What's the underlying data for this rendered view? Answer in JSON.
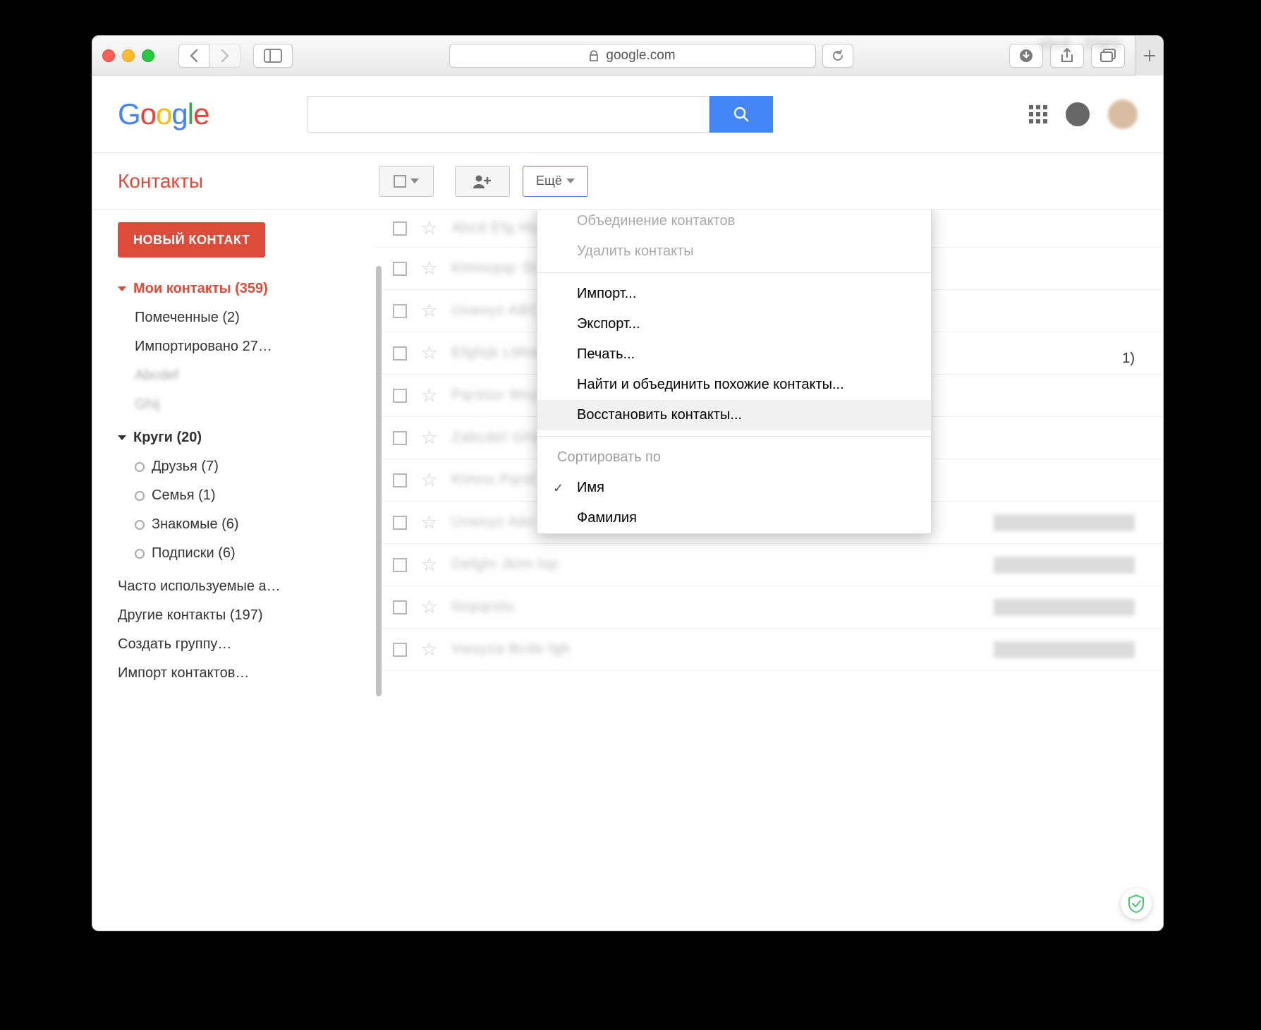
{
  "browser": {
    "address": "google.com"
  },
  "header": {
    "logo": "Google",
    "search_value": ""
  },
  "app_title": "Контакты",
  "toolbar": {
    "more_label": "Ещё"
  },
  "sidebar": {
    "new_contact": "НОВЫЙ КОНТАКТ",
    "my_contacts": "Мои контакты (359)",
    "starred": "Помеченные (2)",
    "imported": "Импортировано 27…",
    "circles": "Круги (20)",
    "circle_items": [
      "Друзья (7)",
      "Семья (1)",
      "Знакомые (6)",
      "Подписки (6)"
    ],
    "frequent": "Часто используемые а…",
    "other": "Другие контакты (197)",
    "create_group": "Создать группу…",
    "import": "Импорт контактов…"
  },
  "menu": {
    "merge": "Объединение контактов",
    "delete": "Удалить контакты",
    "import": "Импорт...",
    "export": "Экспорт...",
    "print": "Печать...",
    "find_merge": "Найти и объединить похожие контакты...",
    "restore": "Восстановить контакты...",
    "sort_by": "Сортировать по",
    "sort_name": "Имя",
    "sort_surname": "Фамилия"
  },
  "visible_extra": "1)"
}
